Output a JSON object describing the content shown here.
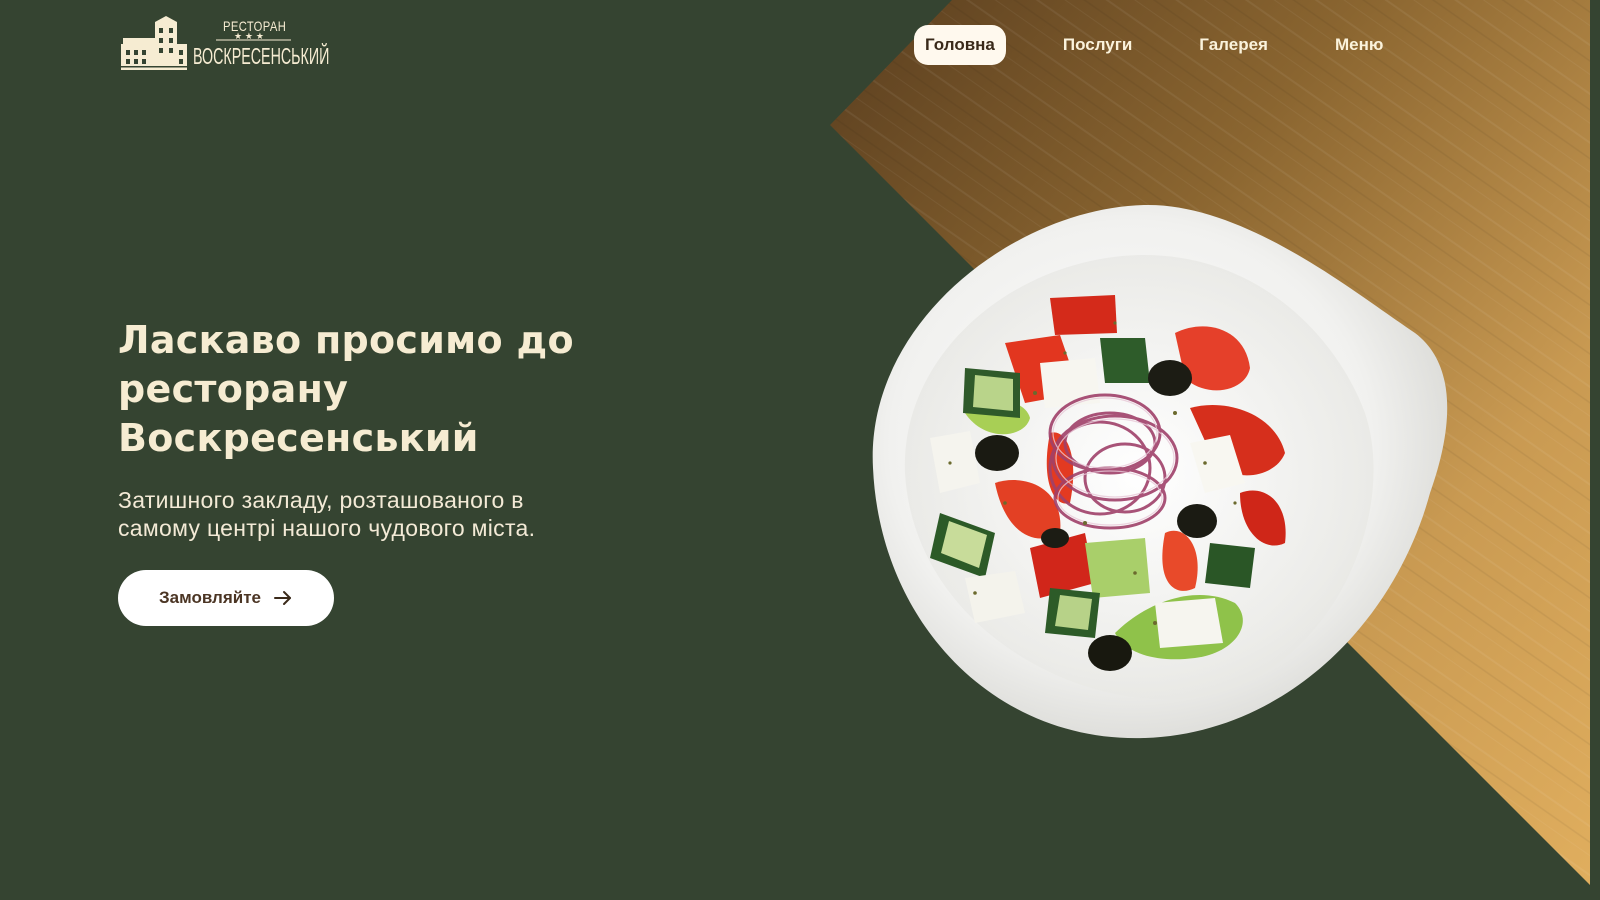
{
  "brand": {
    "logo_top": "РЕСТОРАН",
    "logo_stars": "★ ★ ★",
    "logo_name": "ВОСКРЕСЕНСЬКИЙ"
  },
  "nav": {
    "items": [
      {
        "label": "Головна",
        "active": true
      },
      {
        "label": "Послуги",
        "active": false
      },
      {
        "label": "Галерея",
        "active": false
      },
      {
        "label": "Меню",
        "active": false
      }
    ]
  },
  "hero": {
    "title_lines": [
      "Ласкаво просимо до",
      "ресторану",
      "Воскресенський"
    ],
    "subtitle_lines": [
      "Затишного закладу, розташованого в",
      "самому центрі нашого чудового міста."
    ],
    "cta_label": "Замовляйте",
    "cta_icon": "arrow-right-icon"
  },
  "images": {
    "dish": "greek-salad-bowl",
    "background": "wood-panel"
  },
  "colors": {
    "background": "#354431",
    "text": "#f6ecd2",
    "wood_light": "#d9a55a",
    "wood_dark": "#6b4a24",
    "button_bg": "#ffffff",
    "button_text": "#4b3524"
  }
}
